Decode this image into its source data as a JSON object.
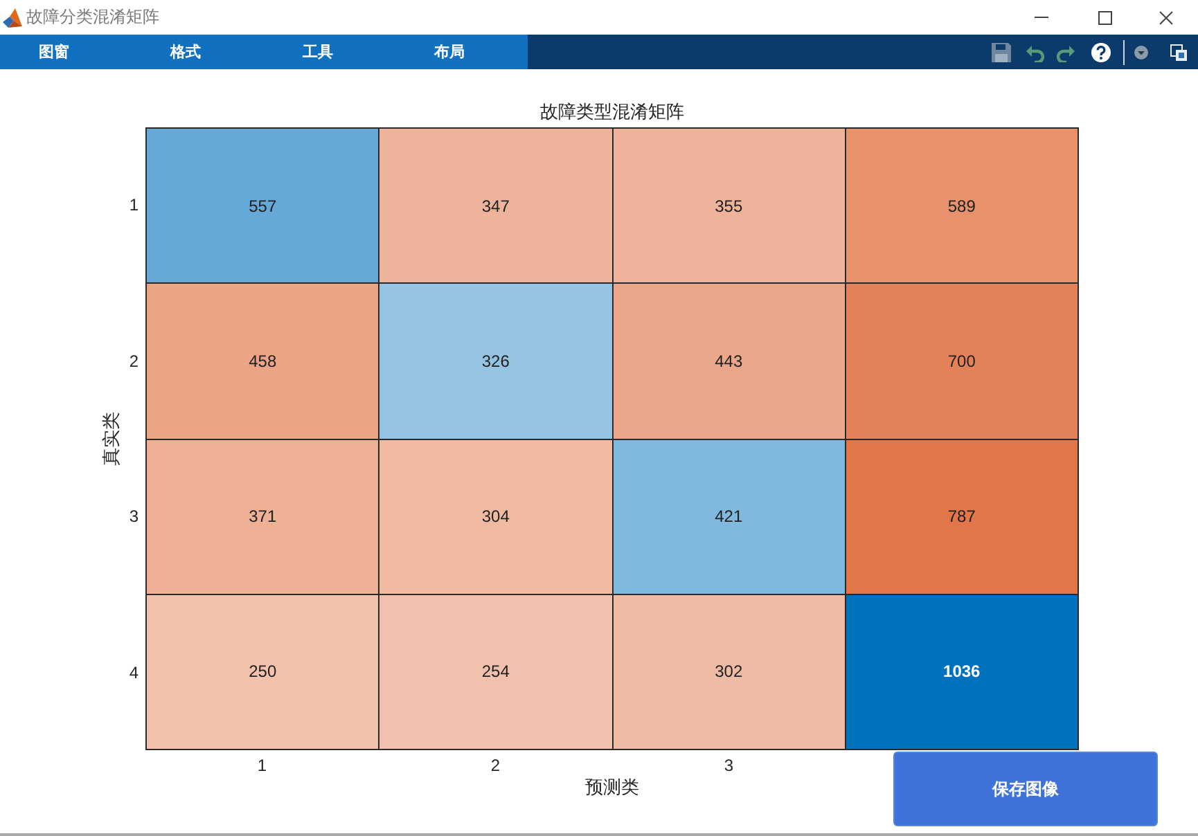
{
  "window": {
    "title": "故障分类混淆矩阵"
  },
  "ribbon": {
    "tabs": [
      "图窗",
      "格式",
      "工具",
      "布局"
    ]
  },
  "figure": {
    "title": "故障类型混淆矩阵",
    "ylabel": "真实类",
    "xlabel": "预测类",
    "row_labels": [
      "1",
      "2",
      "3",
      "4"
    ],
    "column_labels": [
      "1",
      "2",
      "3"
    ],
    "rows": [
      [
        "557",
        "347",
        "355",
        "589"
      ],
      [
        "458",
        "326",
        "443",
        "700"
      ],
      [
        "371",
        "304",
        "421",
        "787"
      ],
      [
        "250",
        "254",
        "302",
        "1036"
      ]
    ]
  },
  "save_button": {
    "label": "保存图像"
  }
}
